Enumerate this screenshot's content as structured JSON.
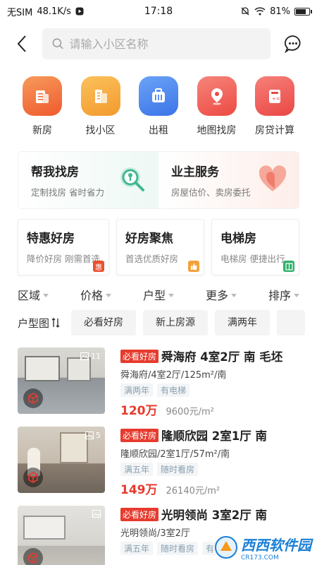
{
  "status": {
    "carrier": "无SIM",
    "speed": "48.1K/s",
    "time": "17:18",
    "battery": "81%",
    "battery_level": 0.81
  },
  "search": {
    "placeholder": "请输入小区名称"
  },
  "quick_nav": [
    {
      "label": "新房",
      "icon": "new-house-icon",
      "color": "#f36e3f"
    },
    {
      "label": "找小区",
      "icon": "building-icon",
      "color": "#f5a13a"
    },
    {
      "label": "出租",
      "icon": "suitcase-icon",
      "color": "#4a87f0"
    },
    {
      "label": "地图找房",
      "icon": "map-pin-icon",
      "color": "#f0524a"
    },
    {
      "label": "房贷计算",
      "icon": "calculator-icon",
      "color": "#ef5350"
    }
  ],
  "services": {
    "find": {
      "title": "帮我找房",
      "sub": "定制找房 省时省力"
    },
    "owner": {
      "title": "业主服务",
      "sub": "房屋估价、卖房委托"
    }
  },
  "promos": [
    {
      "title": "特惠好房",
      "sub": "降价好房 刚需首选",
      "badge": "惠",
      "badge_color": "#e8512f"
    },
    {
      "title": "好房聚焦",
      "sub": "首选优质好房",
      "badge": "👍",
      "badge_color": "#f5a13a"
    },
    {
      "title": "电梯房",
      "sub": "电梯房 便捷出行",
      "badge": "▥",
      "badge_color": "#2fb26b"
    }
  ],
  "filters": [
    "区域",
    "价格",
    "户型",
    "更多",
    "排序"
  ],
  "tag_row": {
    "lead": "户型图",
    "chips": [
      "必看好房",
      "新上房源",
      "满两年"
    ]
  },
  "listings": [
    {
      "badge": "必看好房",
      "title": "舜海府 4室2厅 南 毛坯",
      "desc": "舜海府/4室2厅/125m²/南",
      "tags": [
        "满两年",
        "有电梯"
      ],
      "price": "120万",
      "unit_price": "9600元/m²",
      "img_count": "11",
      "img_colors": [
        "#9aa3a8",
        "#d8d6d0"
      ]
    },
    {
      "badge": "必看好房",
      "title": "隆顺欣园 2室1厅 南",
      "desc": "隆顺欣园/2室1厅/57m²/南",
      "tags": [
        "满五年",
        "随时看房"
      ],
      "price": "149万",
      "unit_price": "26140元/m²",
      "img_count": "5",
      "img_colors": [
        "#c9c2b8",
        "#8f8478"
      ]
    },
    {
      "badge": "必看好房",
      "title": "光明领尚 3室2厅 南",
      "desc": "光明领尚/3室2厅",
      "tags": [
        "满五年",
        "随时看房",
        "有电梯"
      ],
      "price": "",
      "unit_price": "",
      "img_count": "",
      "img_colors": [
        "#c8c8c4",
        "#e6e4e0"
      ]
    }
  ],
  "watermark": {
    "text": "西西软件园",
    "sub": "CR173.COM"
  }
}
